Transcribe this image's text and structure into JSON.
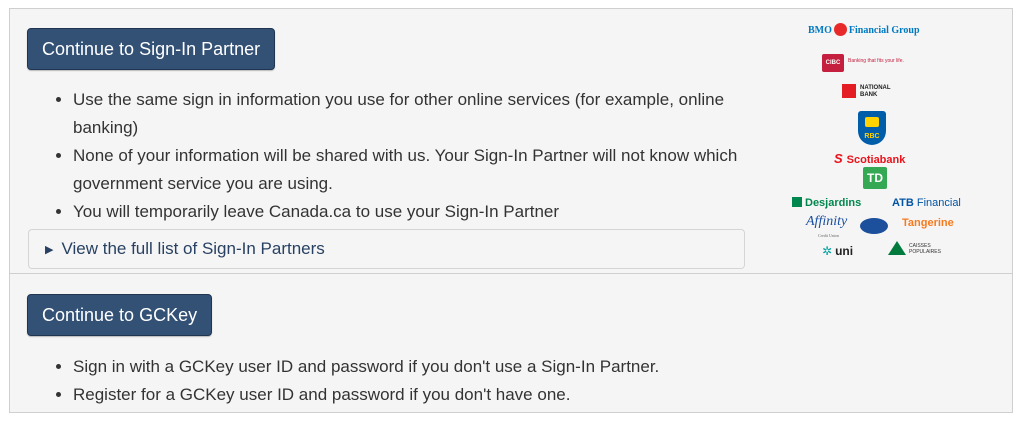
{
  "sign_in_partner": {
    "button_label": "Continue to Sign-In Partner",
    "bullets": [
      "Use the same sign in information you use for other online services (for example, online banking)",
      "None of your information will be shared with us. Your Sign-In Partner will not know which government service you are using.",
      "You will temporarily leave Canada.ca to use your Sign-In Partner"
    ],
    "details_label": "View the full list of Sign-In Partners"
  },
  "partner_logos": {
    "bmo_left": "BMO",
    "bmo_right": "Financial Group",
    "cibc": "CIBC",
    "cibc_tagline": "Banking that fits your life.",
    "national_bank_line1": "NATIONAL",
    "national_bank_line2": "BANK",
    "rbc": "RBC",
    "scotiabank": "Scotiabank",
    "td": "TD",
    "desjardins": "Desjardins",
    "atb_bold": "ATB",
    "atb_rest": "Financial",
    "affinity": "Affinity",
    "affinity_sub": "Credit Union",
    "tangerine": "Tangerine",
    "uni": "uni",
    "caisses_line1": "CAISSES",
    "caisses_line2": "POPULAIRES"
  },
  "gckey": {
    "button_label": "Continue to GCKey",
    "bullets": [
      "Sign in with a GCKey user ID and password if you don't use a Sign-In Partner.",
      "Register for a GCKey user ID and password if you don't have one."
    ]
  },
  "colors": {
    "button_bg": "#335075",
    "link": "#284162",
    "panel_bg": "#f5f5f5",
    "border": "#cfcfcf"
  }
}
